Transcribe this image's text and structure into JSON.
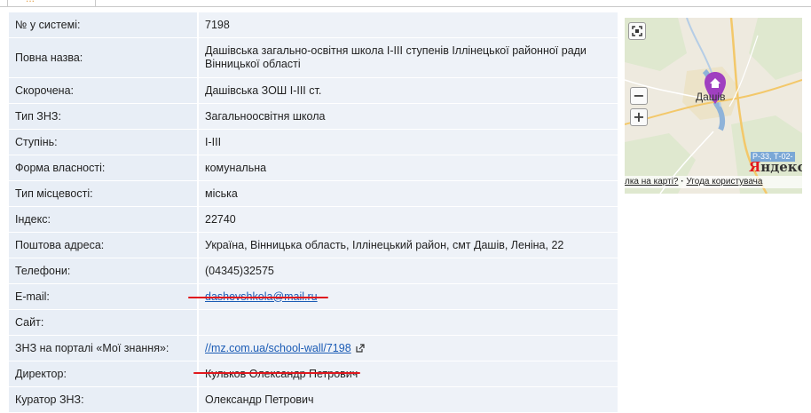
{
  "header": {
    "active_tab_label": "..."
  },
  "rows": [
    {
      "key": "№ у системі:",
      "value": "7198"
    },
    {
      "key": "Повна назва:",
      "value": "Дашівська загально-освітня школа І-ІІІ ступенів Іллінецької районної ради Вінницької області"
    },
    {
      "key": "Скорочена:",
      "value": "Дашівська ЗОШ І-ІІІ ст."
    },
    {
      "key": "Тип ЗНЗ:",
      "value": "Загальноосвітня школа"
    },
    {
      "key": "Ступінь:",
      "value": "І-ІІІ"
    },
    {
      "key": "Форма власності:",
      "value": "комунальна"
    },
    {
      "key": "Тип місцевості:",
      "value": "міська"
    },
    {
      "key": "Індекс:",
      "value": "22740"
    },
    {
      "key": "Поштова адреса:",
      "value": "Україна, Вінницька область, Іллінецький район, смт Дашів, Леніна, 22"
    },
    {
      "key": "Телефони:",
      "value": "(04345)32575"
    },
    {
      "key": "E-mail:",
      "value": "dashevshkola@mail.ru"
    },
    {
      "key": "Сайт:",
      "value": ""
    },
    {
      "key": "ЗНЗ на порталі «Мої знання»:",
      "value": "//mz.com.ua/school-wall/7198"
    },
    {
      "key": "Директор:",
      "value": "Кульков Олександр Петрович"
    },
    {
      "key": "Куратор ЗНЗ:",
      "value": "Олександр Петрович"
    }
  ],
  "map": {
    "city_label": "Дашів",
    "road_label": "Р-33, Т-02-",
    "logo_first": "Я",
    "logo_rest": "ндекс",
    "footer_error_link": "лка на карті?",
    "footer_separator": "·",
    "footer_terms_link": "Угода користувача",
    "zoom_in": "+",
    "zoom_out": "−",
    "fullscreen_icon": "fullscreen-icon"
  },
  "colors": {
    "link": "#1a5bb5",
    "annotation": "#e0181e",
    "pin": "#a040c0"
  }
}
